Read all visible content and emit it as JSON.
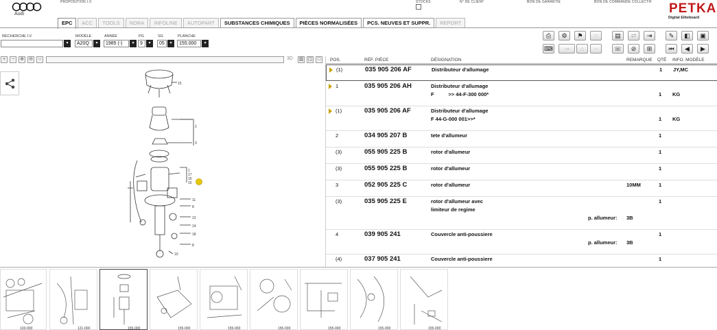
{
  "app": {
    "brand": "Audi",
    "logo_text": "PETKA",
    "logo_subtitle": "Digital Eliteboard",
    "top_labels": [
      "PROPOSITION I.V.",
      "STOCKS",
      "N° DE CLIENT",
      "BON DE GARANTIE",
      "BON DE COMMANDE COLLECTIF"
    ]
  },
  "tabs": [
    {
      "label": "EPC",
      "state": "active"
    },
    {
      "label": "ACC",
      "state": "disabled"
    },
    {
      "label": "TOOLS",
      "state": "disabled"
    },
    {
      "label": "NORA",
      "state": "disabled"
    },
    {
      "label": "INFOLINE",
      "state": "disabled"
    },
    {
      "label": "AUTOPART",
      "state": "disabled"
    },
    {
      "label": "SUBSTANCES CHIMIQUES",
      "state": "enabled"
    },
    {
      "label": "PIÈCES NORMALISÉES",
      "state": "enabled"
    },
    {
      "label": "PCS. NEUVES ET SUPPR.",
      "state": "enabled"
    },
    {
      "label": "REPORT",
      "state": "disabled"
    }
  ],
  "selection": {
    "vin_label": "RECHERCHE I.V.",
    "vin_value": "",
    "model_label": "MODÈLE",
    "model_value": "A20Q",
    "year_label": "ANNÉE",
    "year_value": "1985 (-)",
    "pg_label": "PG",
    "pg_value": "9",
    "sg_label": "SG",
    "sg_value": "05",
    "plate_label": "PLANCHE",
    "plate_value": "155.000"
  },
  "viewer": {
    "label_3d": "3D"
  },
  "parts_table": {
    "headers": {
      "pos": "POS.",
      "ref": "RÉF. PIÈCE",
      "designation": "DÉSIGNATION",
      "remark": "REMARQUE",
      "qty": "QTÉ",
      "info": "INFO. MODÈLE"
    },
    "rows": [
      {
        "pos": "(1)",
        "ref": "035 905 206 AF",
        "designation": "Distributeur d'allumage",
        "designation2": "",
        "remark": "",
        "qty": "1",
        "info": "JY,MC",
        "arrow": true,
        "selected": true
      },
      {
        "pos": "1",
        "ref": "035 905 206 AH",
        "designation": "Distributeur d'allumage",
        "designation2": "F          >> 44-F-300 000*",
        "remark": "",
        "qty": "1",
        "info": "KG",
        "arrow": true,
        "selected": false
      },
      {
        "pos": "(1)",
        "ref": "035 905 206 AF",
        "designation": "Distributeur d'allumage",
        "designation2": "F 44-G-000 001>>*",
        "remark": "",
        "qty": "1",
        "info": "KG",
        "arrow": true,
        "selected": false
      },
      {
        "pos": "2",
        "ref": "034 905 207 B",
        "designation": "tete d'allumeur",
        "designation2": "",
        "remark": "",
        "qty": "1",
        "info": "",
        "arrow": false,
        "selected": false
      },
      {
        "pos": "(3)",
        "ref": "055 905 225 B",
        "designation": "rotor d'allumeur",
        "designation2": "",
        "remark": "",
        "qty": "1",
        "info": "",
        "arrow": false,
        "selected": false
      },
      {
        "pos": "(3)",
        "ref": "055 905 225 B",
        "designation": "rotor d'allumeur",
        "designation2": "",
        "remark": "",
        "qty": "1",
        "info": "",
        "arrow": false,
        "selected": false
      },
      {
        "pos": "3",
        "ref": "052 905 225 C",
        "designation": "rotor d'allumeur",
        "designation2": "",
        "remark": "10MM",
        "qty": "1",
        "info": "",
        "arrow": false,
        "selected": false
      },
      {
        "pos": "(3)",
        "ref": "035 905 225 E",
        "designation": "rotor d'allumeur avec",
        "designation2": "limiteur de regime",
        "remark": "",
        "qty": "1",
        "info": "",
        "arrow": false,
        "selected": false,
        "note_label": "p. allumeur:",
        "note_value": "3B"
      },
      {
        "pos": "4",
        "ref": "039 905 241",
        "designation": "Couvercle anti-poussiere",
        "designation2": "",
        "remark": "",
        "qty": "1",
        "info": "",
        "arrow": false,
        "selected": false,
        "note_label": "p. allumeur:",
        "note_value": "3B"
      },
      {
        "pos": "(4)",
        "ref": "037 905 241",
        "designation": "Couvercle anti-poussiere",
        "designation2": "",
        "remark": "",
        "qty": "1",
        "info": "",
        "arrow": false,
        "selected": false
      }
    ]
  },
  "thumbnails": {
    "captions": [
      "103-000",
      "121-000",
      "155-000",
      "155-000",
      "155-000",
      "155-000",
      "155-000",
      "155-000",
      "155-000"
    ],
    "active_index": 2
  },
  "colors": {
    "logo_red": "#c21a1a",
    "row_arrow": "#c8a000",
    "callout_marker": "#e8c800"
  }
}
